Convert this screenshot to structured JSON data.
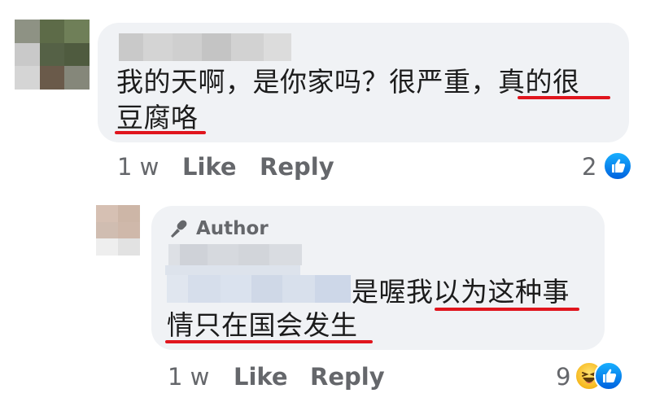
{
  "comment": {
    "text_line1": "我的天啊，是你家吗？很严重，真的很",
    "text_line2": "豆腐咯",
    "time": "1 w",
    "like_label": "Like",
    "reply_label": "Reply",
    "reaction_count": "2",
    "reaction_icons": [
      "like-icon"
    ]
  },
  "reply": {
    "author_badge": "Author",
    "text_line1": "是喔我以为这种事",
    "text_line2": "情只在国会发生",
    "time": "1 w",
    "like_label": "Like",
    "reply_label": "Reply",
    "reaction_count": "9",
    "reaction_icons": [
      "haha-icon",
      "like-icon"
    ]
  },
  "colors": {
    "bubble_bg": "#f0f2f5",
    "underline": "#e0151d",
    "meta_text": "#65676b",
    "like_blue": "#1877f2"
  }
}
